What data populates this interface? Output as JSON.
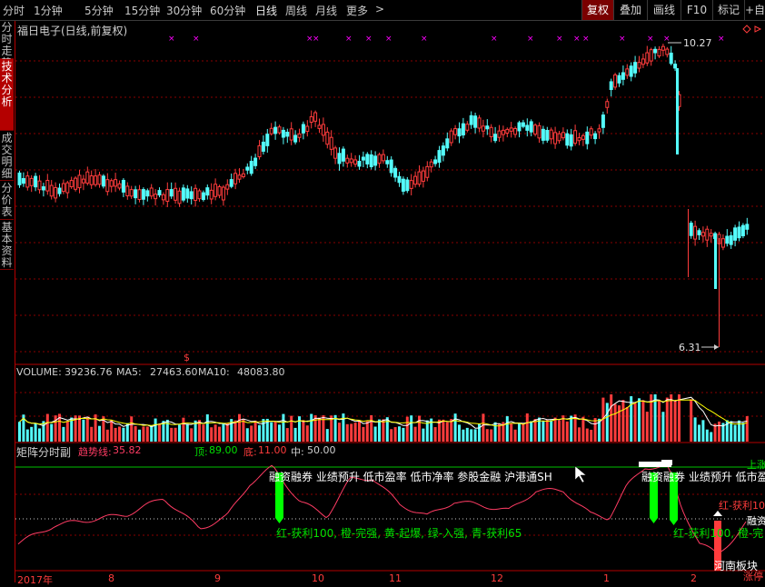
{
  "toolbar": {
    "periods": [
      "分时",
      "1分钟",
      "5分钟",
      "15分钟",
      "30分钟",
      "60分钟",
      "日线",
      "周线",
      "月线",
      "更多"
    ],
    "active_period": "日线",
    "more_arrow": ">",
    "buttons": [
      "复权",
      "叠加",
      "画线",
      "F10",
      "标记",
      "+自选"
    ],
    "active_button": "复权"
  },
  "sidebar": {
    "tabs": [
      "分时走势",
      "技术分析",
      "成交明细",
      "分价表",
      "基本资料"
    ],
    "active_tab": "技术分析"
  },
  "stock": {
    "title": "福日电子(日线,前复权)",
    "high_label": "10.27",
    "low_label": "6.31",
    "dollar_marker": "$"
  },
  "volume_panel": {
    "volume_label": "VOLUME:",
    "volume_value": "39236.76",
    "ma5_label": "MA5:",
    "ma5_value": "27463.60",
    "ma10_label": "MA10:",
    "ma10_value": "48083.80"
  },
  "indicator_panel": {
    "name": "矩阵分时副",
    "trend_label": "趋势线:",
    "trend_value": "35.82",
    "top_label": "顶:",
    "top_value": "89.00",
    "bottom_label": "底:",
    "bottom_value": "11.00",
    "mid_label": "中:",
    "mid_value": "50.00",
    "signal_text_1": "融资融券 业绩预升 低市盈率 低市净率 参股金融 沪港通SH",
    "signal_text_2": "融资融券 业绩预升 低市盈",
    "legend_text_1": "红-获利100, 橙-完强, 黄-起爆, 绿-入强, 青-获利65",
    "legend_text_2": "红-获利100, 橙-完",
    "right_label_1": "上涨",
    "right_label_2": "红-获利10",
    "right_label_3": "融资",
    "right_label_4": "河南板块",
    "right_label_5": "涨停"
  },
  "x_axis": {
    "labels": [
      "2017年",
      "8",
      "9",
      "10",
      "11",
      "12",
      "1",
      "2"
    ]
  },
  "colors": {
    "up": "#ff3c3c",
    "down": "#54fcfc",
    "ma5": "#ffffff",
    "ma10": "#ffff00",
    "trend": "#ff3c64",
    "grid": "#8a0000",
    "green_signal": "#00ff00",
    "magenta_marker": "#ff00ff"
  }
}
